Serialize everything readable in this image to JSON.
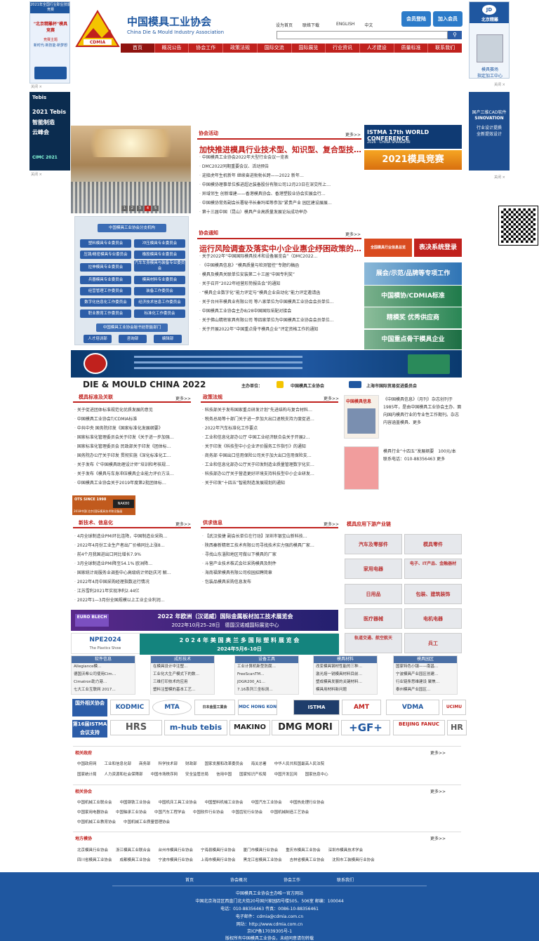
{
  "header": {
    "cn_name": "中国模具工业协会",
    "en_name": "China Die & Mould Industry Association",
    "logo_text": "CDMIA",
    "toplinks": [
      "设为首页",
      "联络下载",
      "ENGLISH",
      "中文"
    ],
    "member_login": "会员登陆",
    "join_member": "加入会员",
    "search_icon": "search-icon"
  },
  "nav": [
    "首页",
    "概况公告",
    "协会工作",
    "政策法规",
    "国际交流",
    "国际展览",
    "行业资讯",
    "人才建设",
    "质量标准",
    "联系我们"
  ],
  "left_ad_top": {
    "title": "2021年全国行业职业技能竞赛",
    "sub": "\"北京精雕杯\"模具竞赛",
    "l1": "竞赛主题",
    "l2": "新时代·新技能·新梦想"
  },
  "left_ad_2": {
    "brand": "Tebis",
    "text1": "2021 Tebis",
    "text2": "智能制造",
    "text3": "云峰会",
    "badge": "CIMC 2021"
  },
  "right_ad_top": {
    "brand": "北京精雕",
    "line1": "模具赛场",
    "line2": "指定加工中心"
  },
  "right_ad_2": {
    "brand": "国产三维CAD软件",
    "line1": "SINOVATION",
    "line2": "行业设计提质",
    "line3": "全新提效设计"
  },
  "close_label": "关闭 ×",
  "news": {
    "title": "协会活动",
    "more": "更多>>",
    "headline": "加快推进模具行业技术型、知识型、复合型技…",
    "items": [
      "中国模具工业协会2022年大型行业会议一览表",
      "DMC2022同期重要会议、活动预告",
      "迎接虎年生机新年 继续奋进勃勃长跨——2022 新年…",
      "中国模协理事单位推进超达装备股份有限公司12月23日在深交所上…",
      "异域邻生 创新增建——香港模具协会、香港塑胶业协会实展会行…",
      "中国模协常务副会长署秘书长秦玛瑶等参加“紧贵产业 园区建设展展…",
      "第十三届中国（昆山）模具产业高质量发展论坛成功举办"
    ],
    "pager": [
      "1",
      "2",
      "3",
      "4",
      "5"
    ]
  },
  "notice": {
    "title": "协会通知",
    "more": "更多>>",
    "headline": "运行风险调查及落实中小企业惠企纾困政策的…",
    "items": [
      "关于2022年“中国国际模具技术和设备展览会”（DMC2022…",
      "《中国模具信息》“模具质量与检测管控”专题约稿函",
      "模具及模具关联单位安装第二十三届“中国专利奖”",
      "关于召开“2022年经营形势报告会”的通知",
      "“模具企业数字化”能力评定与“模具企业自动化”能力评定邀请函",
      "关于台州市模具业有限公司 等八家单位为中国模具工业协会会员单位…",
      "中国模具工业协会主办8/28中国国际采配对接会",
      "关于佛山精密家具有限公司 等四家单位为中国模具工业协会会员单位…",
      "关于开展2022年“中国重点骨干模具企业”评定资格工作的通知"
    ]
  },
  "branch": {
    "title": "中国模具工业协会分支机构",
    "units": [
      "塑料模具专业委员会",
      "冲压模具专业委员会",
      "压铸/精密模具专业委员会",
      "橡胶模具专业委员会",
      "拉伸模具专业委员会",
      "汽车车身模具与装备专业委员会",
      "兵器模具专业委员会",
      "模具材料专业委员会",
      "经营管理工作委员会",
      "装备工作委员会",
      "数字化信息化工作委员会",
      "经济技术信息工作委员会",
      "职业教育工作委员会",
      "标准化工作委员会"
    ],
    "sub_title": "中国模具工业协会秘书处职能部门",
    "depts": [
      "人才培训部",
      "咨询部",
      "编辑部"
    ]
  },
  "right_promos": {
    "istma_title": "ISTMA 17th WORLD CONFERENCE",
    "istma_sub": "2026 · CHINA SHANGHAI",
    "contest": "2021模具竞赛",
    "table_system": "表决系统登录",
    "list_note": "全国模具行业信息总览",
    "brand_project": "展会/示范/品牌等专项工作",
    "standard": "中国模协/CDMIA标准",
    "supplier": "精模奖   优秀供应商",
    "key_enterprise": "中国重点骨干模具企业"
  },
  "dmc": {
    "title": "DIE & MOULD CHINA 2022",
    "host_label": "主办单位：",
    "host1": "中国模具工业协会",
    "host2": "上海市国际贸易促进委员会"
  },
  "standards": {
    "title": "模具标准及关联",
    "more": "更多>>",
    "items": [
      "关于促进团体标准规范化优质发展的意见",
      "中国模具工业协会T/CDMIA标准",
      "中共中央 国务院印发《国家标准化发展纲要》",
      "国家标准化管理委员会关于印发《关于进一步加强…",
      "国家标准化管理委员会 民政部关于印发《团体标…",
      "国务院办公厅关于印发 贯彻实施《深化标准化工…",
      "关于发布《“中国模具助理设计师”培训和考核规…",
      "关于发布《模具与车身冲压模具企业能力评价方法…",
      "中国模具工业协会关于2019年度第2批团体标…"
    ]
  },
  "policy": {
    "title": "政策法规",
    "more": "更多>>",
    "items": [
      "科技部关于发布国家重点研发计划“先进结构与复合材料…",
      "税务总局等十部门关于进一步加大出口退税支持力度促进…",
      "2022年汽车标准化工作要点",
      "工业和信息化部办公厅 中国工业经济联合会关于开展2…",
      "关于印发《科技型中小企业评价服务工作指引》的通知",
      "商务部 中国出口信用保险公司关于加大出口信用保险支…",
      "工业和信息化部办公厅关于印发制造业质量管理数字化实…",
      "科技部办公厅关于营造更好环境支持科技型中小企业研发…",
      "关于印发“十四五”智能制造发展规划的通知"
    ]
  },
  "magazine": {
    "cover_title": "中国模具信息",
    "desc": "《中国模具信息》（月刊）杂志创刊于1985年，是由中国模具工业协会主办、面向国内模具行业的专业性工作期刊。杂志内容涵盖模具、更多",
    "ad_text": "模具行业“十四五”发展纲要　100元/本　联系电话：010-88356463 更多"
  },
  "tech": {
    "title": "新技术、信息化",
    "more": "更多>>",
    "items": [
      "4月全球制造业PMI环比连降，中国制造业采购…",
      "2022年4月份工业生产者出厂价格同比上涨8…",
      "前4个月我国进出口同比增长7.9%",
      "3月全球制造业PMI降至54.1% 欧洲降…",
      "国家统计局服务业调查中心高级统计师赵庆河 解…",
      "2022年4月中国采购经理指数运行情况",
      "江苏雪利2021年实现净利2.44亿",
      "2022年1—3月份全国规模以上工业企业利润…"
    ]
  },
  "supply": {
    "title": "供求信息",
    "more": "更多>>",
    "items": [
      "【武汉俊捷 副会长单位在行动】深圳市银宝山新科技…",
      "陕西秦新精密工技术有限公司寻找技术实力强的模具厂家…",
      "寻找山东淄阳地区可做以下模具的厂家",
      "斗营产业技术株式会社采购模具及制件",
      "海南福荣模具有限公司校园招聘简章",
      "包装品模具采购信息发布"
    ]
  },
  "chain": {
    "title": "模具应用下游产业链",
    "tiles": [
      "汽车及零部件",
      "模具零件",
      "家用电器",
      "电子、IT产品、金融器材",
      "日用品",
      "包装、建筑装饰",
      "医疗器械",
      "电机电器",
      "轨道交通、航空航天",
      "兵工"
    ]
  },
  "banners": {
    "euroblech_logo": "EURO BLECH",
    "euroblech_title": "2022 年欧洲（汉诺威）国际金属板材加工技术展览会",
    "euroblech_date": "2022年10月25–28日　德国汉诺威国际展览中心",
    "npe_logo": "NPE2024",
    "npe_sub": "The Plastics Show",
    "npe_title": "2 0 2 4 年 美 国 奥 兰 多 国 际 塑 料 展 览 会",
    "npe_date": "2024年5月6–10日",
    "ctsinter_logo": "OTS SINCE 1998",
    "ctsinter_sub": "2018中国(北京)国际模具技术和设备展",
    "nak_logo": "NAK80"
  },
  "software": [
    {
      "head": "软件信息",
      "items": [
        "Allegiance模…",
        "德国沃希公司使用Cim…",
        "Cimatron助力港…",
        "七大工业互联网 2017…"
      ]
    },
    {
      "head": "成形技术",
      "items": [
        "在模具设计中注塑…",
        "工业化大生产模式下的数…",
        "三维打印技术的应用",
        "塑料注塑模的基本工艺…"
      ]
    },
    {
      "head": "设备工具",
      "items": [
        "工业计算机新型防腐…",
        "FreeScanTM…",
        "JDGR200_A1…",
        "7.16系列三坐标测…"
      ]
    },
    {
      "head": "模具材料",
      "items": [
        "改变模具钢材性能的三种…",
        "激光熔一锐模具材料目前…",
        "塑成模具发展的关键材料…",
        "模具用材料新问题"
      ]
    },
    {
      "head": "模具园区",
      "items": [
        "国家特色小镇——南昌…",
        "宁波模具产业园区创建…",
        "行业链条思维建设 聚焦…",
        "泰州模具产业园区…"
      ]
    }
  ],
  "intl_partner_label": "国外相关协会",
  "istma_label": "第16届ISTMA会议支持",
  "partners_row1": [
    "KODMIC",
    "MTA",
    "日本金型工業会",
    "MDC HONG KONG",
    "ISTMA",
    "AMT",
    "VDMA",
    "UCIMU"
  ],
  "partners_row2": [
    "HRS",
    "m-hub tebis",
    "MAKINO",
    "DMG MORI",
    "+GF+",
    "BEIJING FANUC",
    "HR"
  ],
  "gov": {
    "title": "相关政府",
    "more": "更多>>",
    "row1": [
      "中国政府网",
      "工业和信息化部",
      "商务部",
      "科学技术部",
      "财政部",
      "国家发展和改革委员会",
      "海关总署",
      "中华人民共和国最高人民法院"
    ],
    "row2": [
      "国家统计局",
      "人力资源和社会保障部",
      "中国市场秩序网",
      "安全监管总局",
      "信用中国",
      "国家知识产权局",
      "中国开发区网",
      "国家信息中心"
    ]
  },
  "assoc": {
    "title": "相关协会",
    "more": "更多>>",
    "row1": [
      "中国机械工业联合会",
      "中国钢铁工业协会",
      "中国机床工具工业协会",
      "中国塑料机械工业协会",
      "中国汽车工业协会",
      "中国热处理行业协会"
    ],
    "row2": [
      "中国家用电器协会",
      "中国轴承工业协会",
      "中国汽车工程学会",
      "中国软件行业协会",
      "中国齿轮行业协会",
      "中国机械制造工艺协会"
    ],
    "row3": [
      "中国机械工业教育协会",
      "中国机械工业质量管理协会"
    ]
  },
  "local": {
    "title": "地方模协",
    "more": "更多>>",
    "row1": [
      "北京模具行业协会",
      "浙江模具工业联合会",
      "台州市模具行业协会",
      "宁海县模具行业协会",
      "厦门市模具行业协会",
      "重庆市模具工业协会",
      "深圳市模具技术学会"
    ],
    "row2": [
      "四川省模具工业协会",
      "成都模具工业协会",
      "宁波市模具行业协会",
      "上海市模具行业协会",
      "黑龙江省模具工业协会",
      "吉林省模具工业协会",
      "沈阳市工装模具行业协会"
    ]
  },
  "footer": {
    "nav": [
      "首页",
      "协会概况",
      "协会工作",
      "联系我们"
    ],
    "lines": [
      "中国模具工业协会主办唯一官方网站",
      "中国北京海淀区西直门北大街20号国兴家园四号楼505、506室  邮编：100044",
      "电话：010-88356463  传真：0086-10-88356461",
      "电子邮件：cdmia@cdmia.com.cn",
      "网站：http://www.cdmia.com.cn",
      "京ICP备17039305号-1",
      "版权所有中国模具工业协会，未经同意请勿转载"
    ]
  },
  "colors": {
    "brand_red": "#c0211d",
    "brand_blue": "#1f57a0",
    "nav_dark": "#8f130f"
  }
}
